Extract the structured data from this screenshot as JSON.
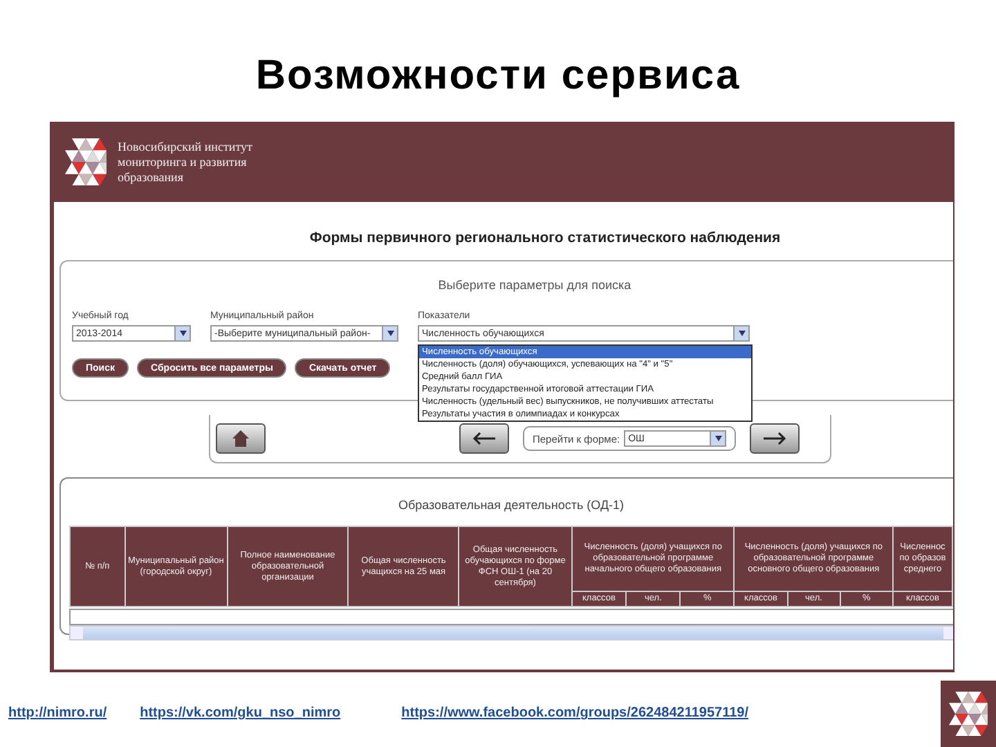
{
  "slide_title": "Возможности сервиса",
  "header": {
    "org_name": [
      "Новосибирский институт",
      "мониторинга и развития",
      "образования"
    ]
  },
  "page_title": "Формы первичного регионального статистического наблюдения",
  "search": {
    "heading": "Выберите параметры для поиска",
    "fields": [
      {
        "label": "Учебный год",
        "value": "2013-2014"
      },
      {
        "label": "Муниципальный район",
        "value": "-Выберите муниципальный район-"
      },
      {
        "label": "Показатели",
        "value": "Численность обучающихся",
        "expanded": true
      }
    ],
    "options": [
      {
        "label": "Численность обучающихся",
        "selected": true
      },
      {
        "label": "Численность (доля) обучающихся, успевающих на \"4\" и \"5\"",
        "selected": false
      },
      {
        "label": "Средний балл ГИА",
        "selected": false
      },
      {
        "label": "Результаты государственной итоговой аттестации ГИА",
        "selected": false
      },
      {
        "label": "Численность (удельный вес) выпускников, не получивших аттестаты",
        "selected": false
      },
      {
        "label": "Результаты участия в олимпиадах и конкурсах",
        "selected": false
      }
    ],
    "buttons": [
      "Поиск",
      "Сбросить все параметры",
      "Скачать отчет"
    ]
  },
  "navigation": {
    "label": "Перейти к форме:",
    "value": "ОШ"
  },
  "table": {
    "caption": "Образовательная деятельность (ОД-1)",
    "columns": [
      {
        "label": "№ п/п"
      },
      {
        "label": "Муниципальный район (городской округ)"
      },
      {
        "label": "Полное наименование образовательной организации"
      },
      {
        "label": "Общая численность учащихся на 25 мая"
      },
      {
        "label": "Общая численность обучающихся по форме ФСН ОШ-1 (на 20 сентября)"
      },
      {
        "label": "Численность (доля) учащихся по образовательной программе начального общего образования",
        "subcolumns": [
          "классов",
          "чел.",
          "%"
        ]
      },
      {
        "label": "Численность (доля) учащихся по образовательной программе основного общего образования",
        "subcolumns": [
          "классов",
          "чел.",
          "%"
        ]
      },
      {
        "label": "Численнос по образов среднего",
        "subcolumns": [
          "классов"
        ]
      }
    ]
  },
  "links": [
    "http://nimro.ru/",
    "https://vk.com/gku_nso_nimro",
    "https://www.facebook.com/groups/262484211957119/"
  ]
}
